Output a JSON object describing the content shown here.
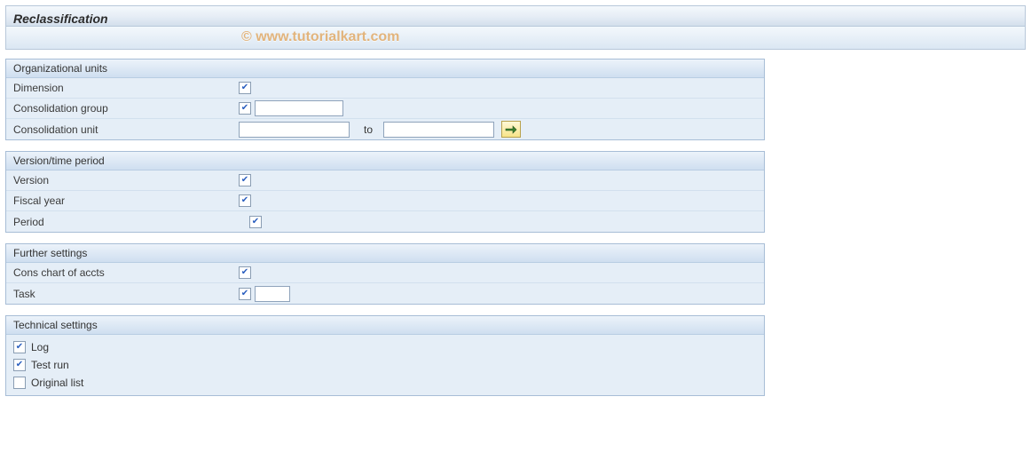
{
  "title": "Reclassification",
  "watermark": "© www.tutorialkart.com",
  "groups": {
    "org": {
      "title": "Organizational units",
      "dimension_label": "Dimension",
      "consolidation_group_label": "Consolidation group",
      "consolidation_group_value": "",
      "consolidation_unit_label": "Consolidation unit",
      "consolidation_unit_from_value": "",
      "to_label": "to",
      "consolidation_unit_to_value": ""
    },
    "version": {
      "title": "Version/time period",
      "version_label": "Version",
      "fiscal_year_label": "Fiscal year",
      "period_label": "Period"
    },
    "further": {
      "title": "Further settings",
      "cons_chart_label": "Cons chart of accts",
      "task_label": "Task",
      "task_value": ""
    },
    "technical": {
      "title": "Technical settings",
      "log_label": "Log",
      "log_checked": true,
      "test_run_label": "Test run",
      "test_run_checked": true,
      "original_list_label": "Original list",
      "original_list_checked": false
    }
  }
}
